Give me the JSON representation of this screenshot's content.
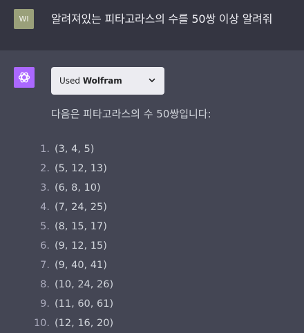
{
  "user": {
    "avatar_initials": "WI",
    "message": "알려져있는 피타고라스의 수를 50쌍 이상 알려줘"
  },
  "assistant": {
    "avatar_icon": "openai-logo-icon",
    "avatar_color": "#ab68ff",
    "plugin": {
      "prefix": "Used",
      "name": "Wolfram",
      "icon": "chevron-down-icon"
    },
    "intro": "다음은 피타고라스의 수 50쌍입니다:",
    "items": [
      {
        "num": "1.",
        "text": "(3, 4, 5)"
      },
      {
        "num": "2.",
        "text": "(5, 12, 13)"
      },
      {
        "num": "3.",
        "text": "(6, 8, 10)"
      },
      {
        "num": "4.",
        "text": "(7, 24, 25)"
      },
      {
        "num": "5.",
        "text": "(8, 15, 17)"
      },
      {
        "num": "6.",
        "text": "(9, 12, 15)"
      },
      {
        "num": "7.",
        "text": "(9, 40, 41)"
      },
      {
        "num": "8.",
        "text": "(10, 24, 26)"
      },
      {
        "num": "9.",
        "text": "(11, 60, 61)"
      },
      {
        "num": "10.",
        "text": "(12, 16, 20)"
      }
    ]
  }
}
